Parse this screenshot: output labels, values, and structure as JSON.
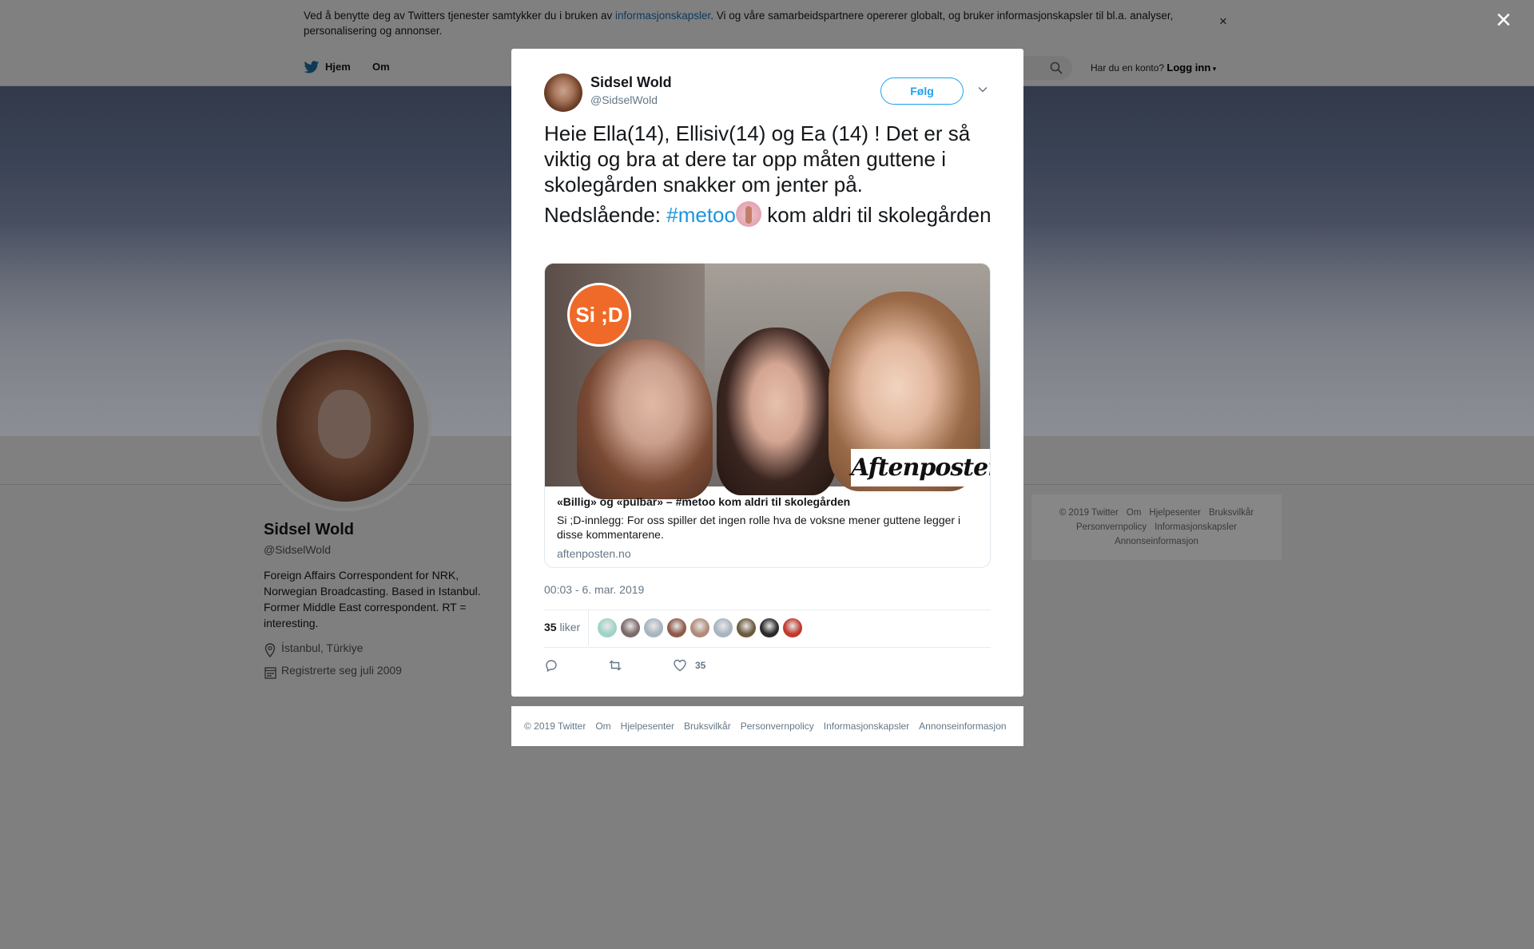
{
  "cookie_banner": {
    "text_before": "Ved å benytte deg av Twitters tjenester samtykker du i bruken av ",
    "link": "informasjonskapsler",
    "text_after": ". Vi og våre samarbeidspartnere opererer globalt, og bruker informasjonskapsler til bl.a. analyser, personalisering og annonser.",
    "close": "×"
  },
  "modal_close": "×",
  "nav": {
    "home": "Hjem",
    "about": "Om",
    "account_question": "Har du en konto?",
    "login": "Logg inn"
  },
  "profile": {
    "name": "Sidsel Wold",
    "handle": "@SidselWold",
    "bio": "Foreign Affairs Correspondent for NRK, Norwegian Broadcasting. Based in Istanbul. Former Middle East correspondent. RT = interesting.",
    "location": "İstanbul, Türkiye",
    "joined": "Registrerte seg juli 2009"
  },
  "side_footer": {
    "items": [
      "© 2019 Twitter",
      "Om",
      "Hjelpesenter",
      "Bruksvilkår",
      "Personvernpolicy",
      "Informasjonskapsler",
      "Annonseinformasjon"
    ]
  },
  "tweet": {
    "author_name": "Sidsel Wold",
    "author_handle": "@SidselWold",
    "follow_label": "Følg",
    "text_p1": "Heie Ella(14), Ellisiv(14) og Ea (14) ! Det er så viktig og bra at dere tar opp måten guttene i skolegården snakker om jenter på.",
    "text_p2_before": "Nedslående: ",
    "hashtag": "#metoo",
    "text_p2_after": " kom aldri til skolegården",
    "card": {
      "logo_text": "Si ;D",
      "publisher_logo": "Aftenposten",
      "title": "«Billig» og «pulbar» – #metoo kom aldri til skolegården",
      "description": "Si ;D-innlegg: For oss spiller det ingen rolle hva de voksne mener guttene legger i disse kommentarene.",
      "domain": "aftenposten.no"
    },
    "timestamp": "00:03 - 6. mar. 2019",
    "likes_count": "35",
    "likes_label": "liker",
    "liker_colors": [
      "#9fd3c7",
      "#7d6a6a",
      "#a8b4c0",
      "#8e5a4a",
      "#b08b7a",
      "#a8b4c0",
      "#6b5a3e",
      "#2a2a2a",
      "#c0392b"
    ],
    "action_like_count": "35"
  },
  "modal_footer": {
    "items": [
      "© 2019 Twitter",
      "Om",
      "Hjelpesenter",
      "Bruksvilkår",
      "Personvernpolicy",
      "Informasjonskapsler",
      "Annonseinformasjon"
    ]
  }
}
